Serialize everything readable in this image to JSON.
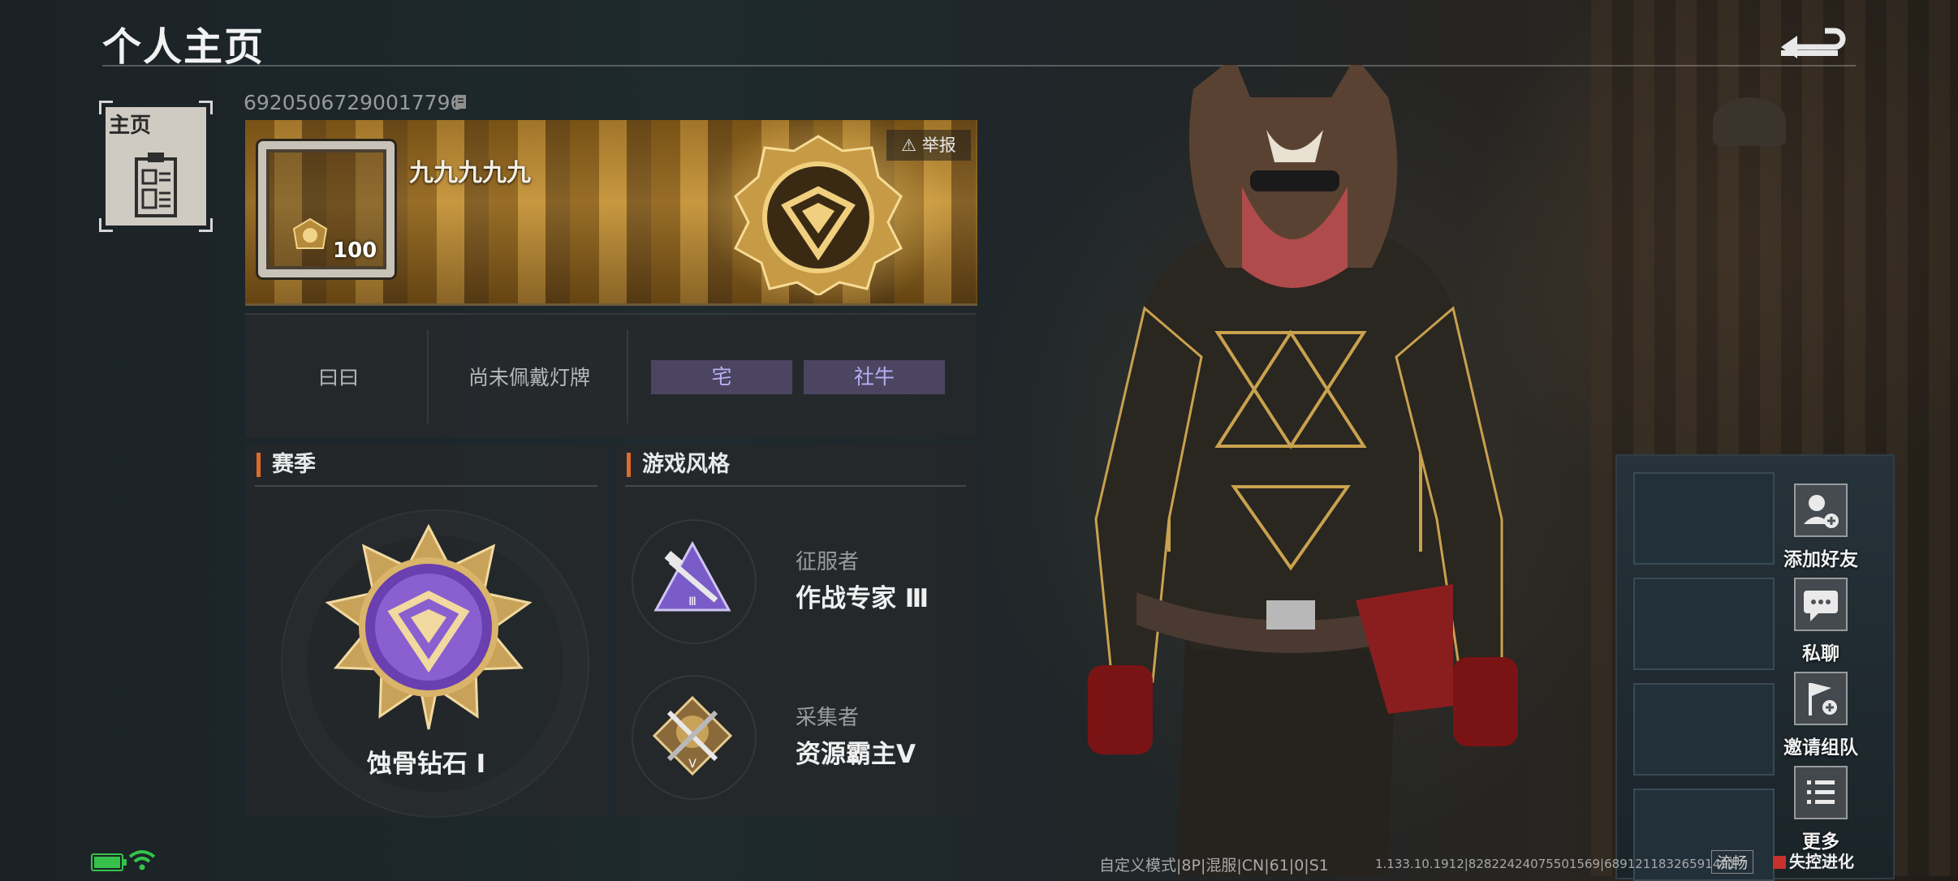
{
  "header": {
    "title": "个人主页"
  },
  "nav": {
    "home_label": "主页"
  },
  "profile": {
    "user_id": "69205067290017796",
    "nickname": "九九九九九",
    "level": "100",
    "report_label": "举报"
  },
  "tags": {
    "signature": "曰曰",
    "badge_status": "尚未佩戴灯牌",
    "chips": [
      "宅",
      "社牛"
    ]
  },
  "season": {
    "title": "赛季",
    "rank_name": "蚀骨钻石 Ⅰ"
  },
  "play_style": {
    "title": "游戏风格",
    "items": [
      {
        "role": "征服者",
        "title": "作战专家 Ⅲ"
      },
      {
        "role": "采集者",
        "title": "资源霸主Ⅴ"
      }
    ]
  },
  "actions": [
    {
      "label": "添加好友",
      "icon": "add-friend-icon"
    },
    {
      "label": "私聊",
      "icon": "chat-icon"
    },
    {
      "label": "邀请组队",
      "icon": "invite-team-icon"
    },
    {
      "label": "更多",
      "icon": "more-list-icon"
    }
  ],
  "status_bar": {
    "server_info": "自定义模式|8P|混服|CN|61|0|S1",
    "build_info": "1.133.10.1912|82822424075501569|68912118326591491",
    "fps_label": "流畅",
    "brand": "失控进化"
  },
  "colors": {
    "accent_orange": "#e06a2a",
    "chip_bg": "#4b4562",
    "chip_text": "#b9aef3",
    "battery": "#36c24a"
  }
}
